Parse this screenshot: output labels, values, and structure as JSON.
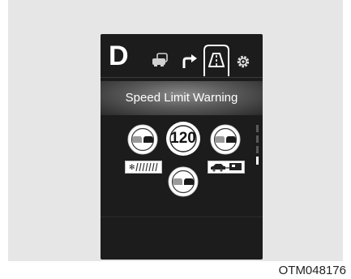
{
  "display": {
    "gear": "D",
    "title": "Speed Limit Warning",
    "tabs": [
      {
        "icon": "vehicle-driving-assist-icon"
      },
      {
        "icon": "turn-navigation-icon"
      },
      {
        "icon": "lane-road-icon",
        "selected": true
      },
      {
        "icon": "gear-settings-icon"
      }
    ],
    "speed_limit": "120",
    "signs": [
      {
        "icon": "no-overtaking-sign-icon"
      },
      {
        "icon": "no-overtaking-sign-icon"
      },
      {
        "icon": "no-overtaking-sign-icon"
      }
    ],
    "supplementary": [
      {
        "icon": "weather-snow-rain-plate-icon"
      },
      {
        "icon": "car-trailer-plate-icon"
      }
    ],
    "scroll": {
      "pages": 4,
      "current": 4
    }
  },
  "caption": "OTM048176",
  "colors": {
    "display_bg": "#1c1c1c",
    "header_band": "#6a6a6a",
    "sign_ring": "#ffffff",
    "car_left": "#9a9a9a",
    "car_right": "#1a1a1a"
  }
}
